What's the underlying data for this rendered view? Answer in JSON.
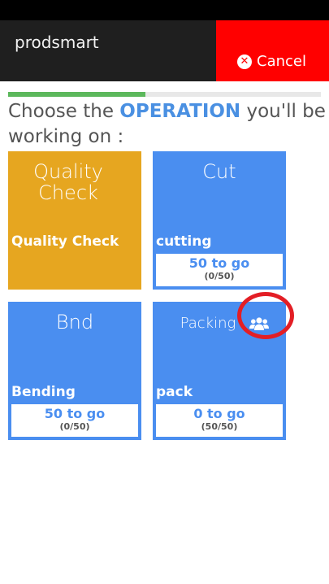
{
  "header": {
    "app_title": "prodsmart",
    "cancel_label": "Cancel"
  },
  "progress": {
    "fraction": 0.44
  },
  "prompt": {
    "prefix": "Choose the ",
    "emphasis": "OPERATION",
    "suffix": " you'll be working on :"
  },
  "operations": [
    {
      "title": "Quality Check",
      "label": "Quality Check",
      "color": "#e6a620"
    },
    {
      "title": "Cut",
      "label": "cutting",
      "count": "50 to go",
      "progress": "(0/50)",
      "color": "#4a8ef0"
    },
    {
      "title": "Bnd",
      "label": "Bending",
      "count": "50 to go",
      "progress": "(0/50)",
      "color": "#4a8ef0"
    },
    {
      "title": "Packing",
      "label": "pack",
      "count": "0 to go",
      "progress": "(50/50)",
      "color": "#4a8ef0",
      "icon": "team-icon"
    }
  ],
  "colors": {
    "accent": "#4a90e2",
    "cancel": "#ff0000",
    "quality": "#e6a620",
    "highlight_ring": "#e31e25"
  }
}
